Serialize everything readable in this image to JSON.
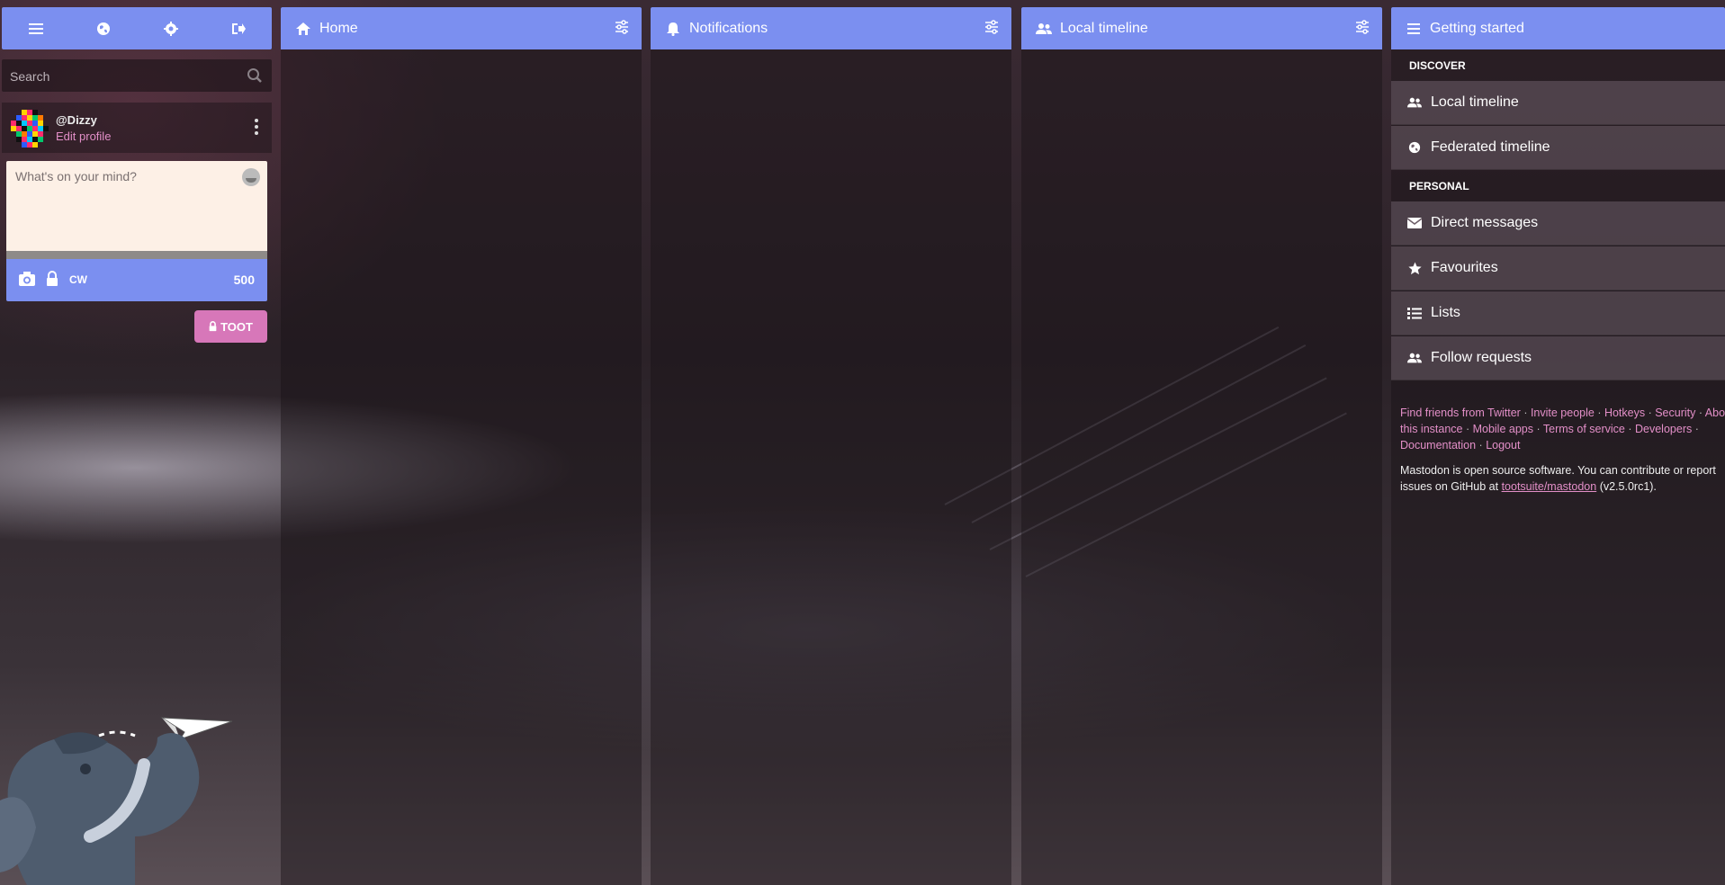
{
  "drawer": {
    "header_icons": [
      "menu-icon",
      "globe-icon",
      "gear-icon",
      "sign-out-icon"
    ],
    "search": {
      "placeholder": "Search"
    },
    "account": {
      "handle": "@Dizzy",
      "edit_profile": "Edit profile"
    },
    "compose": {
      "placeholder": "What's on your mind?",
      "cw_label": "CW",
      "char_count": "500",
      "toot_label": "TOOT"
    }
  },
  "columns": {
    "home": {
      "title": "Home"
    },
    "notifications": {
      "title": "Notifications"
    },
    "local": {
      "title": "Local timeline"
    },
    "getting_started": {
      "title": "Getting started",
      "discover_label": "DISCOVER",
      "personal_label": "PERSONAL",
      "discover_items": [
        {
          "label": "Local timeline",
          "icon": "users-icon"
        },
        {
          "label": "Federated timeline",
          "icon": "globe-icon"
        }
      ],
      "personal_items": [
        {
          "label": "Direct messages",
          "icon": "envelope-icon"
        },
        {
          "label": "Favourites",
          "icon": "star-icon"
        },
        {
          "label": "Lists",
          "icon": "list-icon"
        },
        {
          "label": "Follow requests",
          "icon": "users-icon"
        }
      ],
      "links": [
        "Find friends from Twitter",
        "Invite people",
        "Hotkeys",
        "Security",
        "About this instance",
        "Mobile apps",
        "Terms of service",
        "Developers",
        "Documentation",
        "Logout"
      ],
      "about_prefix": "Mastodon is open source software. You can contribute or report issues on GitHub at",
      "about_link": "tootsuite/mastodon",
      "about_suffix": "(v2.5.0rc1)."
    }
  },
  "colors": {
    "accent": "#7b8ff0",
    "pink": "#e38fc8",
    "toot_button": "#d777b9"
  }
}
